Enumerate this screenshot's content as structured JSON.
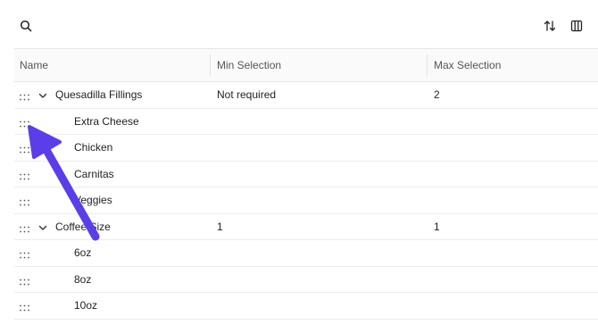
{
  "toolbar": {
    "search_icon": "search-icon",
    "sort_icon": "sort-icon",
    "columns_icon": "columns-icon"
  },
  "table": {
    "columns": [
      "Name",
      "Min Selection",
      "Max Selection"
    ],
    "rows": [
      {
        "name": "Quesadilla Fillings",
        "min": "Not required",
        "max": "2",
        "level": 0,
        "expanded": true
      },
      {
        "name": "Extra Cheese",
        "min": "",
        "max": "",
        "level": 1
      },
      {
        "name": "Chicken",
        "min": "",
        "max": "",
        "level": 1
      },
      {
        "name": "Carnitas",
        "min": "",
        "max": "",
        "level": 1
      },
      {
        "name": "Veggies",
        "min": "",
        "max": "",
        "level": 1
      },
      {
        "name": "Coffee Size",
        "min": "1",
        "max": "1",
        "level": 0,
        "expanded": true
      },
      {
        "name": "6oz",
        "min": "",
        "max": "",
        "level": 1
      },
      {
        "name": "8oz",
        "min": "",
        "max": "",
        "level": 1
      },
      {
        "name": "10oz",
        "min": "",
        "max": "",
        "level": 1
      }
    ]
  },
  "annotation": {
    "color": "#5b3ee8"
  }
}
